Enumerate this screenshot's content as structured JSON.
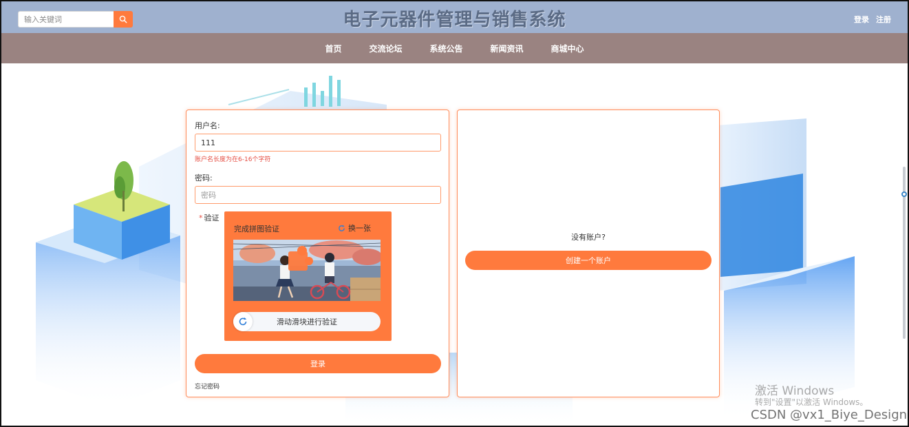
{
  "header": {
    "search_placeholder": "输入关键词",
    "site_title": "电子元器件管理与销售系统",
    "login_link": "登录",
    "register_link": "注册"
  },
  "nav": {
    "items": [
      "首页",
      "交流论坛",
      "系统公告",
      "新闻资讯",
      "商城中心"
    ]
  },
  "login_form": {
    "username_label": "用户名:",
    "username_value": "111",
    "username_error": "账户名长度为在6-16个字符",
    "password_label": "密码:",
    "password_placeholder": "密码",
    "verify_star": "*",
    "verify_label": "验证",
    "captcha_title": "完成拼图验证",
    "captcha_refresh": "换一张",
    "slider_text": "滑动滑块进行验证",
    "submit_label": "登录",
    "forgot_label": "忘记密码"
  },
  "register_panel": {
    "no_account_text": "没有账户?",
    "create_button": "创建一个账户"
  },
  "overlay": {
    "activate_title": "激活 Windows",
    "activate_sub": "转到\"设置\"以激活 Windows。",
    "csdn_watermark": "CSDN @vx1_Biye_Design"
  },
  "colors": {
    "topbar": "#9fb1cf",
    "navbar": "#9a8381",
    "accent": "#ff7a3d"
  }
}
